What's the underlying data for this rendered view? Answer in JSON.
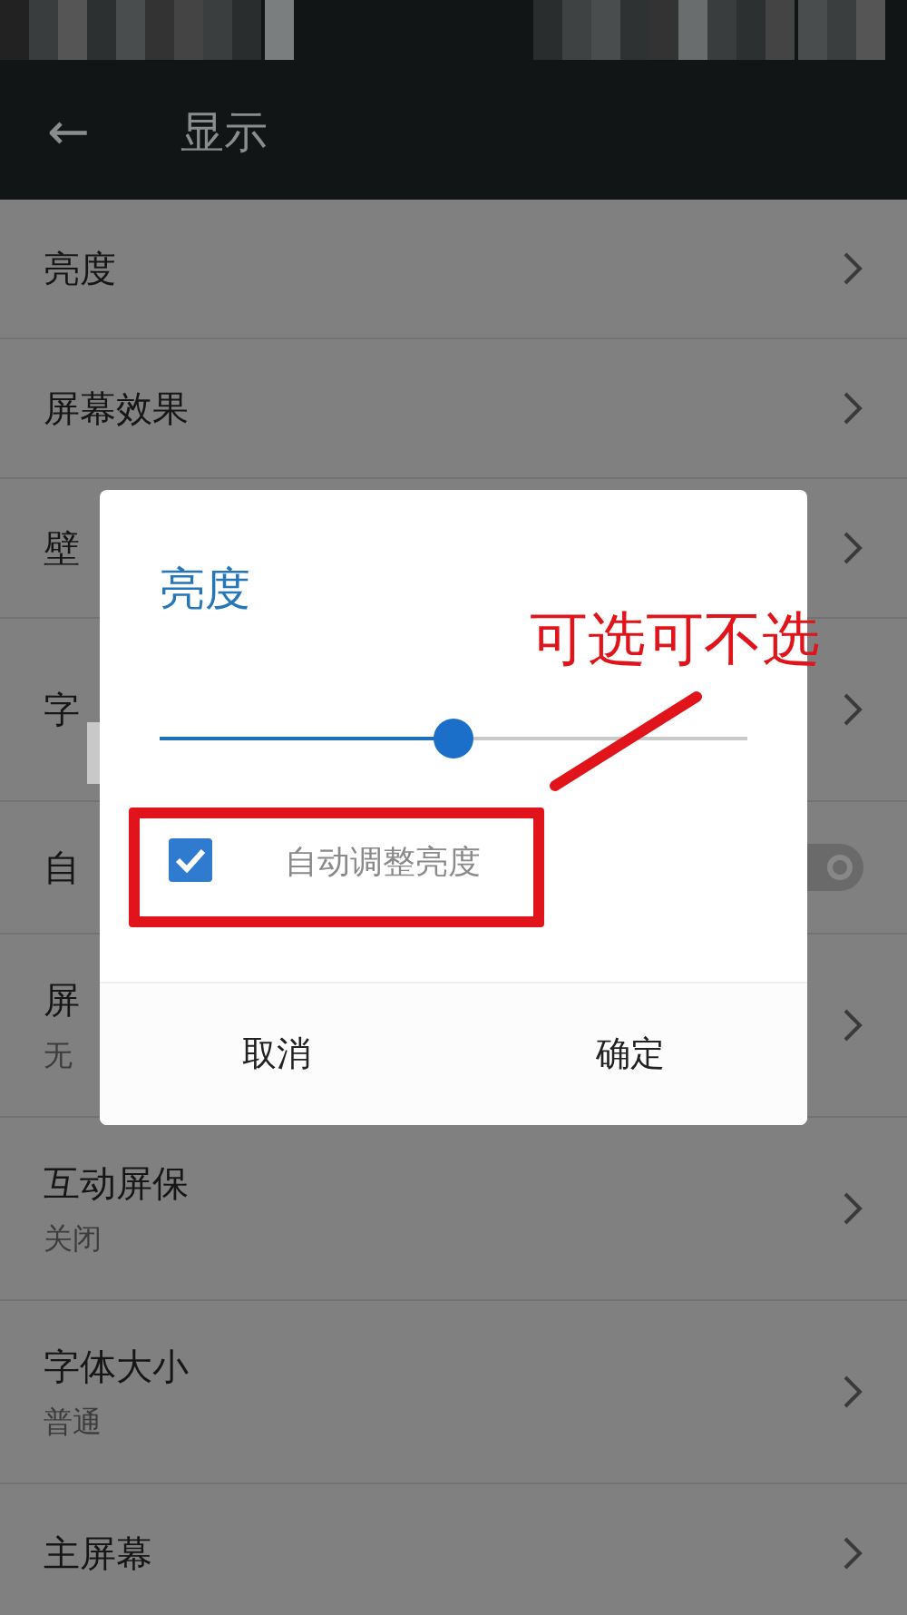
{
  "toolbar": {
    "back": "←",
    "title": "显示"
  },
  "settings": [
    {
      "title": "亮度",
      "kind": "link"
    },
    {
      "title": "屏幕效果",
      "kind": "link"
    },
    {
      "title": "壁",
      "kind": "link"
    },
    {
      "title": "字",
      "kind": "link",
      "redacted": true
    },
    {
      "title": "自",
      "kind": "toggle",
      "on": true
    },
    {
      "title": "屏",
      "subtitle": "无",
      "kind": "link"
    },
    {
      "title": "互动屏保",
      "subtitle": "关闭",
      "kind": "link"
    },
    {
      "title": "字体大小",
      "subtitle": "普通",
      "kind": "link"
    },
    {
      "title": "主屏幕",
      "kind": "link"
    }
  ],
  "dialog": {
    "title": "亮度",
    "slider": {
      "level": 0.5
    },
    "checkbox": {
      "label": "自动调整亮度",
      "checked": true
    },
    "buttons": [
      "取消",
      "确定"
    ]
  },
  "annotation": {
    "text": "可选可不选"
  }
}
